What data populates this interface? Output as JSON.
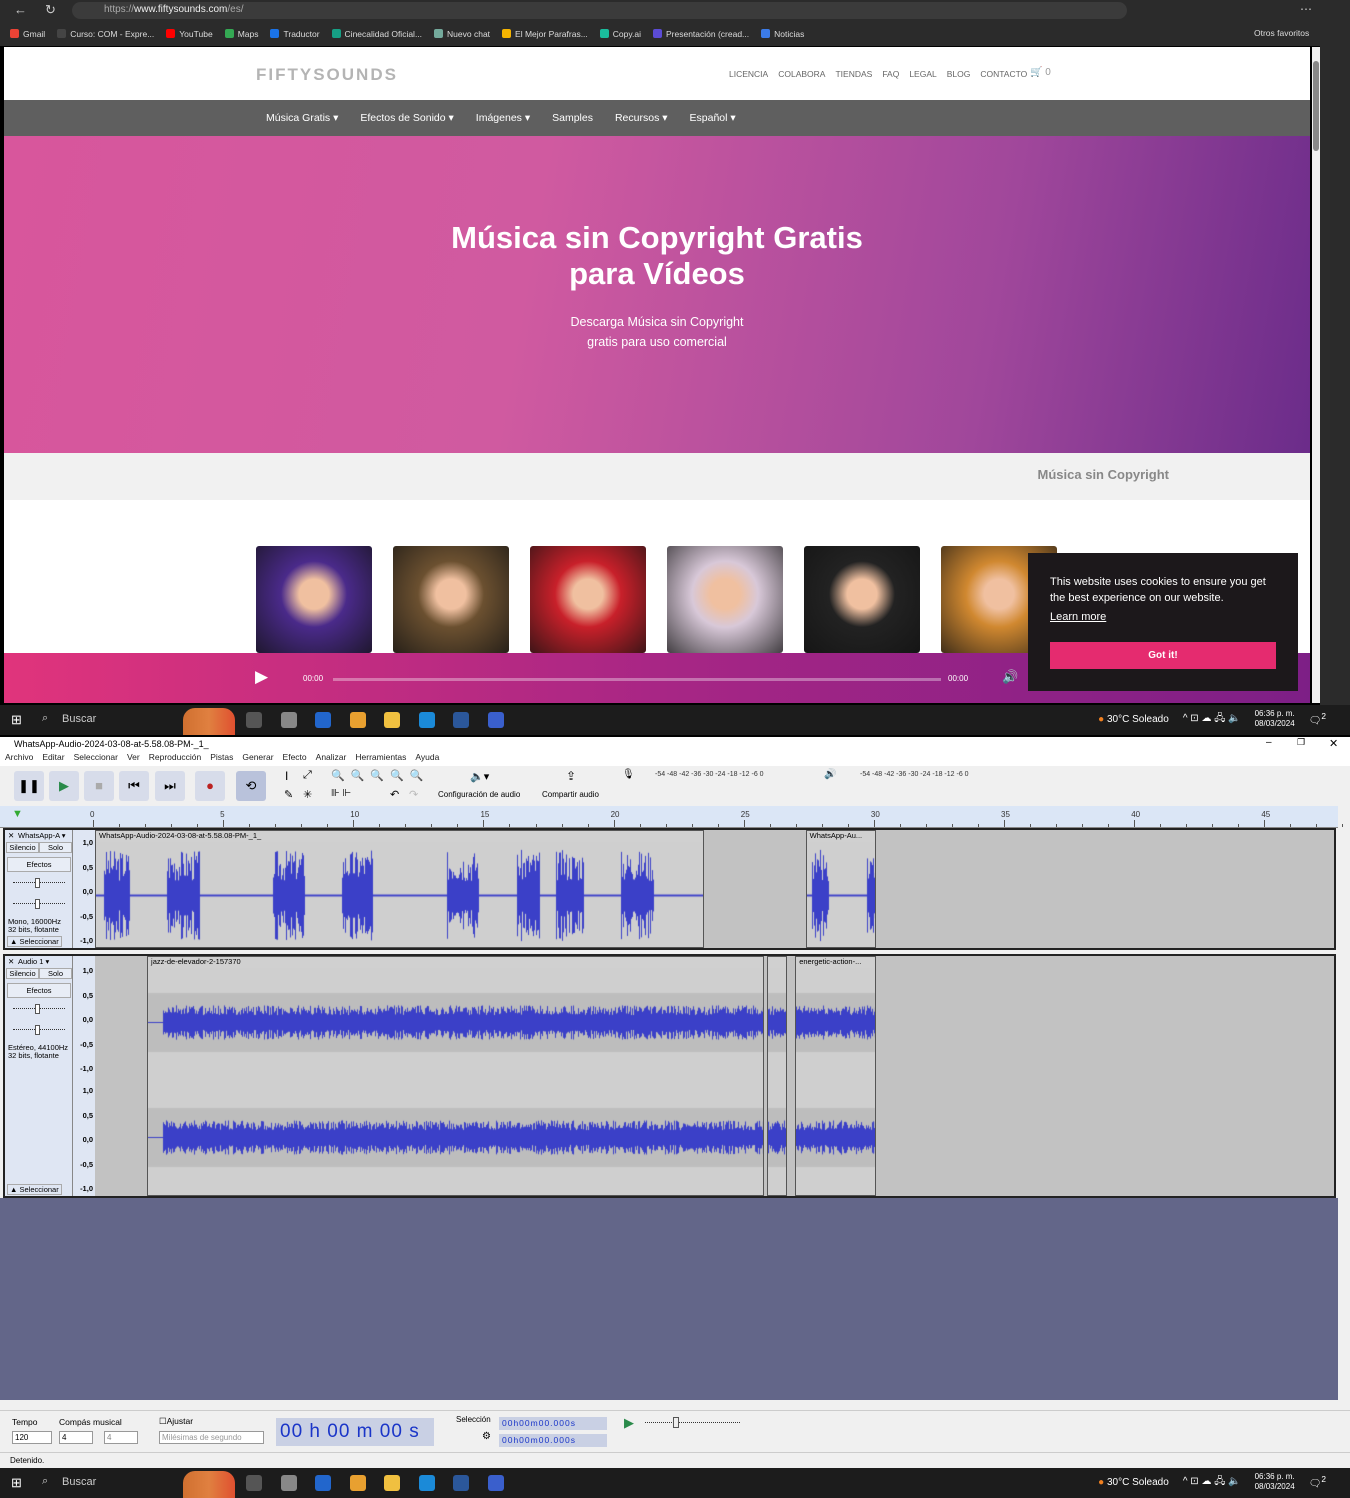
{
  "browser": {
    "url_prefix": "https://",
    "url_domain": "www.fiftysounds.com",
    "url_path": "/es/",
    "bookmarks": [
      {
        "label": "Gmail",
        "color": "#ea4335"
      },
      {
        "label": "Curso: COM - Expre...",
        "color": "#444"
      },
      {
        "label": "YouTube",
        "color": "#ff0000"
      },
      {
        "label": "Maps",
        "color": "#34a853"
      },
      {
        "label": "Traductor",
        "color": "#1a73e8"
      },
      {
        "label": "Cinecalidad Oficial...",
        "color": "#16a085"
      },
      {
        "label": "Nuevo chat",
        "color": "#74aa9c"
      },
      {
        "label": "El Mejor Parafras...",
        "color": "#f5b400"
      },
      {
        "label": "Copy.ai",
        "color": "#1abc9c"
      },
      {
        "label": "Presentación (cread...",
        "color": "#5b4bd5"
      },
      {
        "label": "Noticias",
        "color": "#3b7be8"
      }
    ],
    "other_favorites": "Otros favoritos"
  },
  "site": {
    "logo": "FIFTYSOUNDS",
    "top_nav": [
      "LICENCIA",
      "COLABORA",
      "TIENDAS",
      "FAQ",
      "LEGAL",
      "BLOG",
      "CONTACTO"
    ],
    "cart_count": "0",
    "main_nav": [
      "Música Gratis ▾",
      "Efectos de Sonido ▾",
      "Imágenes ▾",
      "Samples",
      "Recursos ▾",
      "Español ▾"
    ],
    "hero_title_1": "Música sin Copyright Gratis",
    "hero_title_2": "para Vídeos",
    "hero_sub_1": "Descarga Música sin Copyright",
    "hero_sub_2": "gratis para uso comercial",
    "section_title": "Música sin Copyright",
    "thumb_colors": [
      "#4a2a8a",
      "#6b5030",
      "#c8202a",
      "#d8c8d8",
      "#222",
      "#d08830"
    ],
    "player": {
      "current": "00:00",
      "duration": "00:00"
    },
    "cookie": {
      "text": "This website uses cookies to ensure you get the best experience on our website.",
      "learn_more": "Learn more",
      "button": "Got it!"
    }
  },
  "taskbar": {
    "search": "Buscar",
    "weather": "30°C  Soleado",
    "time": "06:36 p. m.",
    "date": "08/03/2024",
    "notifications": "2"
  },
  "audacity": {
    "title": "WhatsApp-Audio-2024-03-08-at-5.58.08-PM-_1_",
    "menu": [
      "Archivo",
      "Editar",
      "Seleccionar",
      "Ver",
      "Reproducción",
      "Pistas",
      "Generar",
      "Efecto",
      "Analizar",
      "Herramientas",
      "Ayuda"
    ],
    "audio_setup": "Configuración de audio",
    "share_audio": "Compartir audio",
    "meter_ticks": "-54 -48 -42 -36 -30 -24 -18 -12 -6 0",
    "ruler_ticks": [
      0,
      5,
      10,
      15,
      20,
      25,
      30,
      35,
      40,
      45
    ],
    "tracks": [
      {
        "name": "WhatsApp-A",
        "mute": "Silencio",
        "solo": "Solo",
        "effects": "Efectos",
        "info_1": "Mono, 16000Hz",
        "info_2": "32 bits, flotante",
        "select": "Seleccionar",
        "scale": [
          "1,0",
          "0,5",
          "0,0",
          "-0,5",
          "-1,0"
        ],
        "clips": [
          {
            "name": "WhatsApp-Audio-2024-03-08-at-5.58.08-PM-_1_",
            "start": 0,
            "end": 23.4
          },
          {
            "name": "WhatsApp-Au...",
            "start": 27.3,
            "end": 30
          }
        ]
      },
      {
        "name": "Audio 1",
        "mute": "Silencio",
        "solo": "Solo",
        "effects": "Efectos",
        "info_1": "Estéreo, 44100Hz",
        "info_2": "32 bits, flotante",
        "select": "Seleccionar",
        "scale": [
          "1,0",
          "0,5",
          "0,0",
          "-0,5",
          "-1,0"
        ],
        "clips": [
          {
            "name": "jazz-de-elevador-2-157370",
            "start": 2,
            "end": 25.7
          },
          {
            "name": "",
            "start": 25.8,
            "end": 26.6
          },
          {
            "name": "energetic-action-...",
            "start": 26.9,
            "end": 30
          }
        ]
      }
    ],
    "bottom": {
      "tempo_label": "Tempo",
      "tempo": "120",
      "meter_label": "Compás musical",
      "meter_num": "4",
      "meter_den": "4",
      "snap_label": "Ajustar",
      "snap_unit": "Milésimas de segundo",
      "time": "00 h 00 m 00 s",
      "selection_label": "Selección",
      "sel_start": "00h00m00.000s",
      "sel_end": "00h00m00.000s"
    },
    "status": "Detenido."
  }
}
